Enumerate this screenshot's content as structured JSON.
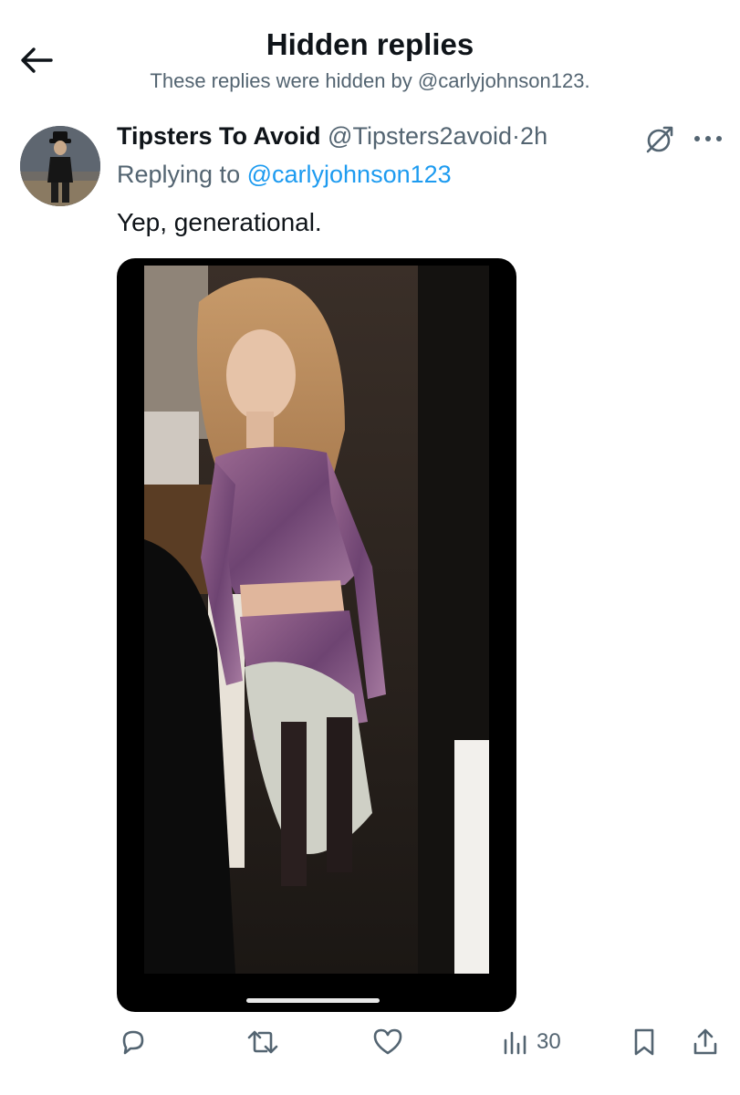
{
  "header": {
    "title": "Hidden replies",
    "subtitle": "These replies were hidden by @carlyjohnson123."
  },
  "tweet": {
    "display_name": "Tipsters To Avoid",
    "handle": "@Tipsters2avoid",
    "separator": "·",
    "time": "2h",
    "replying_prefix": "Replying to",
    "replying_to": "@carlyjohnson123",
    "text": "Yep, generational.",
    "icons": [
      "hidden-reply-icon",
      "more-icon"
    ]
  },
  "actions": {
    "views": "30",
    "icons": [
      "reply-icon",
      "retweet-icon",
      "like-icon",
      "views-icon",
      "bookmark-icon",
      "share-icon"
    ]
  },
  "colors": {
    "text": "#0f1419",
    "secondary": "#536471",
    "link": "#1d9bf0"
  }
}
